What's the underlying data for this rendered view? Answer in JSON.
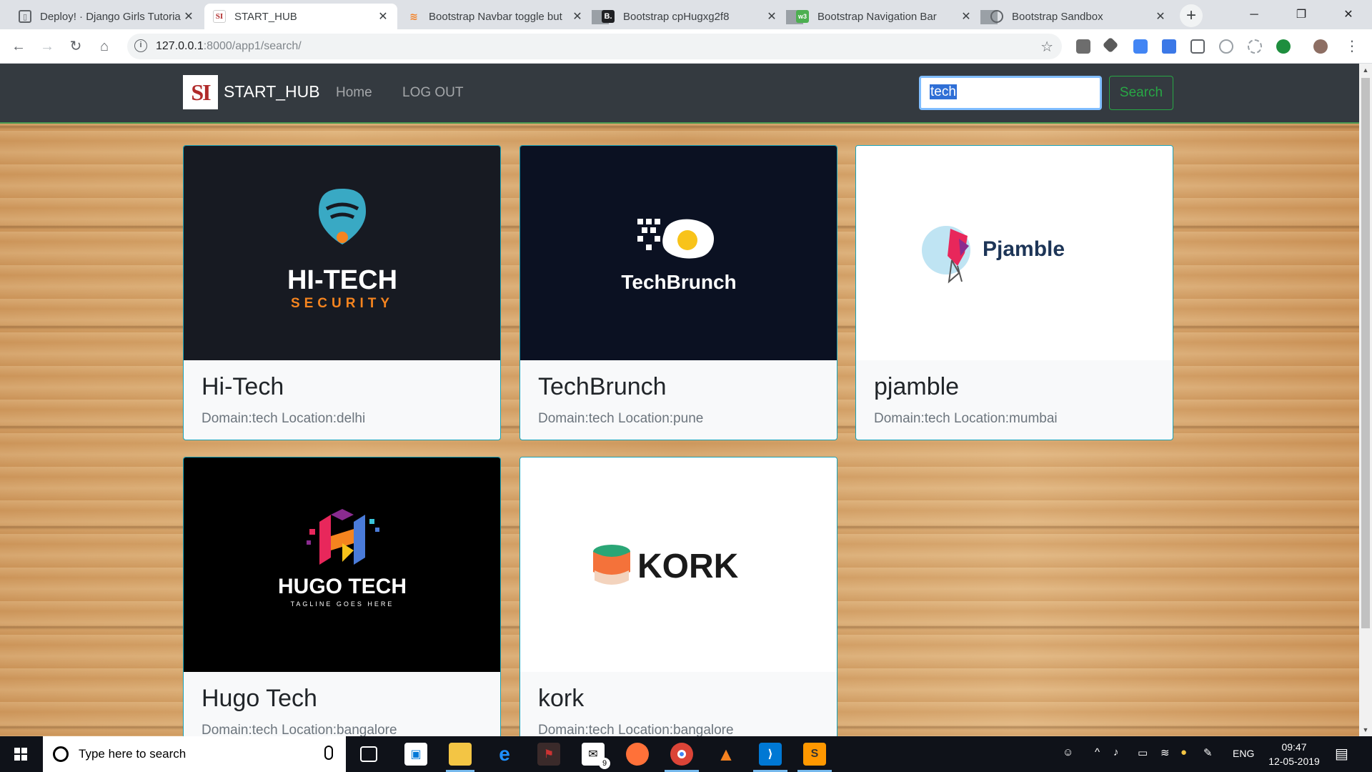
{
  "browser": {
    "tabs": [
      {
        "title": "Deploy! · Django Girls Tutoria",
        "favicon": "book-icon"
      },
      {
        "title": "START_HUB",
        "favicon": "si-logo-icon"
      },
      {
        "title": "Bootstrap Navbar toggle but",
        "favicon": "stackoverflow-icon"
      },
      {
        "title": "Bootstrap cpHugxg2f8",
        "favicon": "bootply-icon"
      },
      {
        "title": "Bootstrap Navigation Bar",
        "favicon": "w3schools-icon"
      },
      {
        "title": "Bootstrap Sandbox",
        "favicon": "globe-icon"
      }
    ],
    "active_tab": 1,
    "url_host": "127.0.0.1",
    "url_rest": ":8000/app1/search/"
  },
  "navbar": {
    "brand_logo": "SI",
    "brand": "START_HUB",
    "links": [
      "Home",
      "LOG OUT"
    ],
    "search_value": "tech",
    "search_button": "Search"
  },
  "cards": [
    {
      "title": "Hi-Tech",
      "meta": "Domain:tech Location:delhi",
      "logo_line1": "HI-TECH",
      "logo_line2": "SECURITY",
      "bg": "#171a22"
    },
    {
      "title": "TechBrunch",
      "meta": "Domain:tech Location:pune",
      "logo_line1": "TechBrunch",
      "logo_line2": "",
      "bg": "#0b1122"
    },
    {
      "title": "pjamble",
      "meta": "Domain:tech Location:mumbai",
      "logo_line1": "Pjamble",
      "logo_line2": "",
      "bg": "#ffffff"
    },
    {
      "title": "Hugo Tech",
      "meta": "Domain:tech Location:bangalore",
      "logo_line1": "HUGO TECH",
      "logo_line2": "TAGLINE GOES HERE",
      "bg": "#000000"
    },
    {
      "title": "kork",
      "meta": "Domain:tech Location:bangalore",
      "logo_line1": "KORK",
      "logo_line2": "",
      "bg": "#ffffff"
    }
  ],
  "taskbar": {
    "search_placeholder": "Type here to search",
    "mail_badge": "9",
    "lang": "ENG",
    "time": "09:47",
    "date": "12-05-2019"
  },
  "colors": {
    "navbar_bg": "#343a40",
    "card_border": "#17a2b8",
    "search_btn": "#28a745"
  }
}
